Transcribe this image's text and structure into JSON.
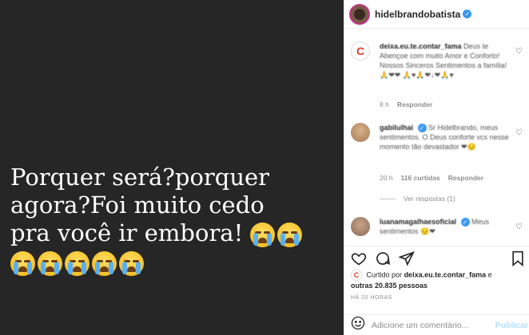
{
  "post": {
    "text_lines": [
      "Porquer será?porquer",
      "agora?Foi muito cedo",
      "pra você ir embora!"
    ],
    "emoji_name": "loudly-crying-face"
  },
  "header": {
    "username": "hidelbrandobatista",
    "verified": true
  },
  "comments": [
    {
      "username": "deixa.eu.te.contar_fama",
      "text": "Deus te Abençoe com muito Amor e Conforto! Nossos Sinceros Sentimentos a família! 🙏❤❤ 🙏♥🙏❤↓❤🙏♥",
      "time": "8 h",
      "likes": "",
      "reply_label": "Responder"
    },
    {
      "username": "gabilulhai",
      "verified": true,
      "text": "Sr Hidelbrando, meus sentimentos. O Deus conforte vcs nesse momento tão devastador ❤😔",
      "time": "20 h",
      "likes": "116 curtidas",
      "reply_label": "Responder",
      "view_replies": "Ver respostas (1)"
    },
    {
      "username": "luanamagalhaesoficial",
      "verified": true,
      "text": "Meus sentimentos 😔❤",
      "time": "",
      "likes": "",
      "reply_label": ""
    }
  ],
  "likes_summary": {
    "prefix": "Curtido por",
    "user": "deixa.eu.te.contar_fama",
    "connector": "e",
    "others": "outras 20.835 pessoas"
  },
  "timestamp": "HÁ 20 HORAS",
  "add_comment": {
    "placeholder": "Adicione um comentário...",
    "publish_label": "Publicar"
  },
  "colors": {
    "accent": "#3897f0",
    "publish_disabled": "#b2dffc",
    "post_bg": "#262626"
  }
}
